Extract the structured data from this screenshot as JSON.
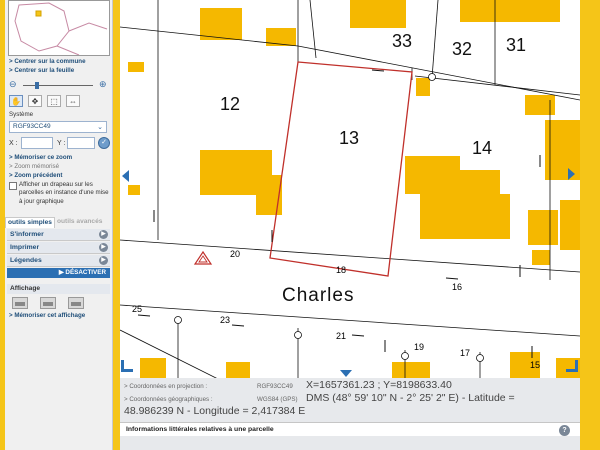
{
  "sidebar": {
    "links_top": [
      "> Centrer sur la commune",
      "> Centrer sur la feuille"
    ],
    "system_label": "Système",
    "system_value": "RGF93CC49",
    "x_label": "X :",
    "y_label": "Y :",
    "go_icon": "check-icon",
    "memorise_zoom": "> Mémoriser ce zoom",
    "zoom_memorise": "> Zoom mémorisé",
    "zoom_precedent": "> Zoom précédent",
    "flag_label": "Afficher un drapeau sur les parcelles en instance d'une mise à jour graphique",
    "tab_simple": "outils simples",
    "tab_advanced": "outils avancés",
    "menu": [
      "S'informer",
      "Imprimer",
      "Légendes"
    ],
    "deactivate": "▶ DÉSACTIVER",
    "affichage": "Affichage",
    "memorise_affichage": "> Mémoriser cet affichage"
  },
  "map": {
    "parcels": [
      {
        "label": "12"
      },
      {
        "label": "13"
      },
      {
        "label": "14"
      },
      {
        "label": "31"
      },
      {
        "label": "32"
      },
      {
        "label": "33"
      }
    ],
    "street_name": "Charles",
    "house_numbers": [
      "20",
      "18",
      "16",
      "25",
      "23",
      "21",
      "19",
      "17",
      "15"
    ],
    "selected_parcel": "13",
    "colors": {
      "building": "#f5b800",
      "selection": "#c0302b",
      "frame": "#f5c518",
      "accent": "#2b6fb3"
    }
  },
  "infopanel": {
    "proj_label": "> Coordonnées en projection :",
    "proj_system": "RGF93CC49",
    "geo_label": "> Coordonnées géographiques :",
    "geo_system": "WGS84 (GPS)",
    "coords_line1": "X=1657361.23 ; Y=8198633.40",
    "coords_line2": "DMS (48° 59' 10\" N - 2° 25' 2\" E) - Latitude =",
    "coords_line3": "48.986239 N - Longitude = 2,417384 E",
    "info_header": "Informations littérales relatives à une parcelle"
  }
}
